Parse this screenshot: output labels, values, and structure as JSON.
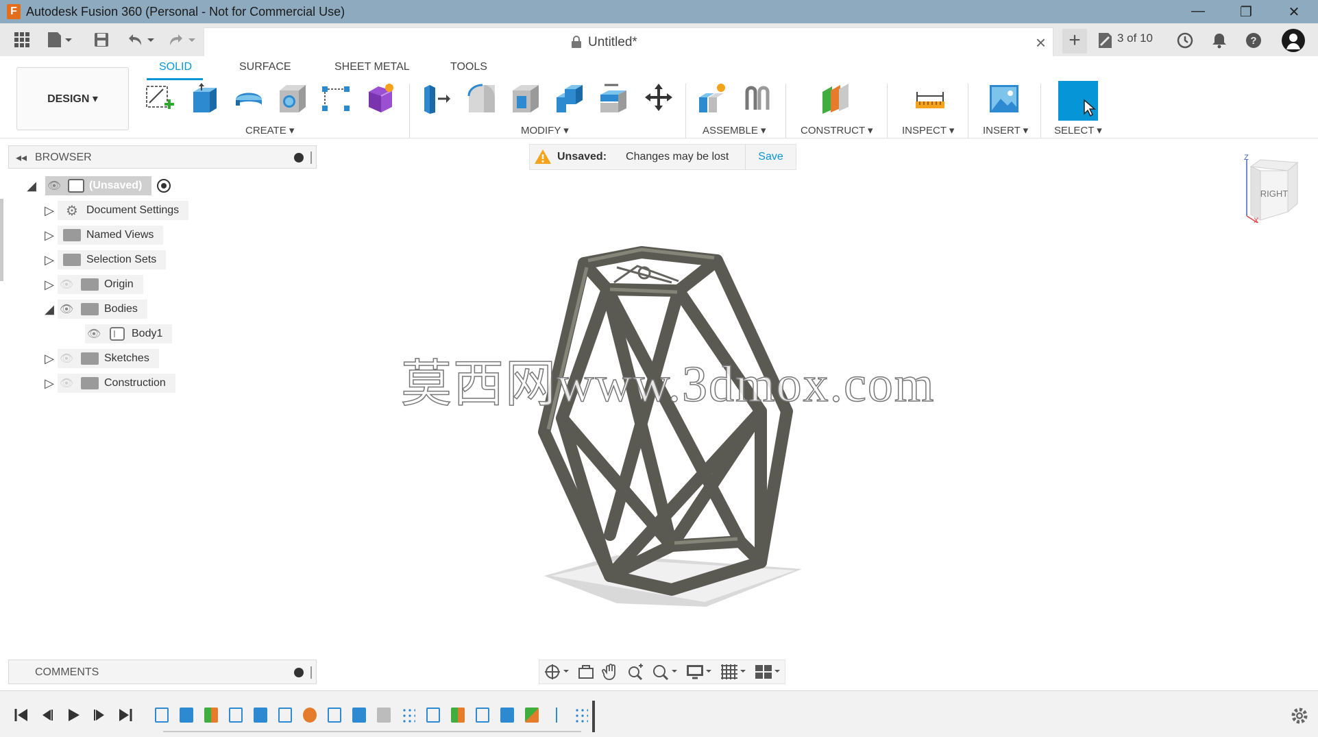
{
  "window": {
    "title": "Autodesk Fusion 360 (Personal - Not for Commercial Use)",
    "app_icon_letter": "F",
    "minimize": "—",
    "restore": "❐",
    "close": "✕"
  },
  "quickbar": {
    "doc_title": "Untitled*",
    "close_tab": "×",
    "new_tab": "+",
    "job_status": "3 of 10"
  },
  "workspace": {
    "label": "DESIGN ▾"
  },
  "tabs": [
    {
      "label": "SOLID",
      "active": true
    },
    {
      "label": "SURFACE",
      "active": false
    },
    {
      "label": "SHEET METAL",
      "active": false
    },
    {
      "label": "TOOLS",
      "active": false
    }
  ],
  "groups": {
    "create": "CREATE ▾",
    "modify": "MODIFY ▾",
    "assemble": "ASSEMBLE ▾",
    "construct": "CONSTRUCT ▾",
    "inspect": "INSPECT ▾",
    "insert": "INSERT ▾",
    "select": "SELECT ▾"
  },
  "browser": {
    "title": "BROWSER",
    "collapse": "◂◂",
    "root": "(Unsaved)",
    "items": [
      {
        "label": "Document Settings"
      },
      {
        "label": "Named Views"
      },
      {
        "label": "Selection Sets"
      },
      {
        "label": "Origin"
      },
      {
        "label": "Bodies"
      },
      {
        "label": "Body1"
      },
      {
        "label": "Sketches"
      },
      {
        "label": "Construction"
      }
    ]
  },
  "banner": {
    "status": "Unsaved:",
    "message": "Changes may be lost",
    "save": "Save"
  },
  "viewcube": {
    "face": "RIGHT",
    "axis_z": "Z",
    "axis_x": "X"
  },
  "watermark": "莫西网www.3dmox.com",
  "comments": {
    "title": "COMMENTS"
  },
  "colors": {
    "accent": "#0696d7",
    "titlebar": "#8eaabf",
    "model": "#6b6a61"
  }
}
